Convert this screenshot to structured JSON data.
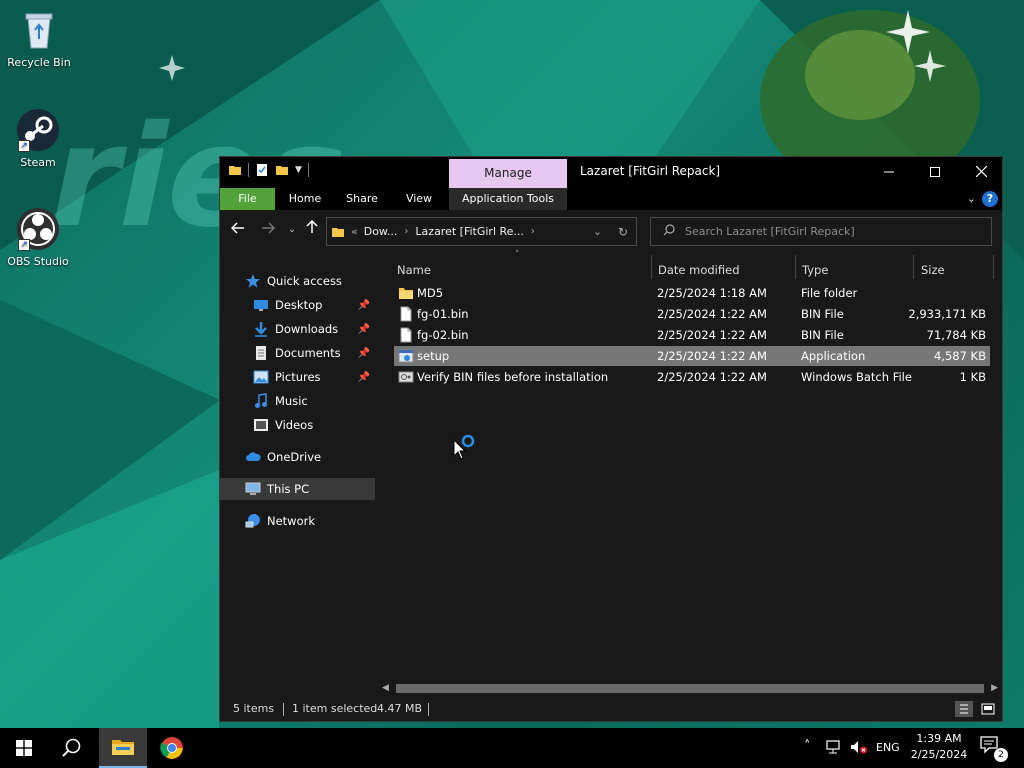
{
  "desktop": {
    "icons": [
      {
        "label": "Recycle Bin"
      },
      {
        "label": "Steam"
      },
      {
        "label": "OBS Studio"
      }
    ]
  },
  "window": {
    "title": "Lazaret [FitGirl Repack]",
    "context_tab": "Manage",
    "ribbon_tabs": [
      "File",
      "Home",
      "Share",
      "View",
      "Application Tools"
    ],
    "help_label": "?",
    "address": {
      "overflow": "«",
      "crumbs": [
        "Dow...",
        "Lazaret [FitGirl Re..."
      ]
    },
    "search_placeholder": "Search Lazaret [FitGirl Repack]",
    "nav": {
      "quick_access": "Quick access",
      "items": [
        {
          "label": "Desktop",
          "pinned": true
        },
        {
          "label": "Downloads",
          "pinned": true
        },
        {
          "label": "Documents",
          "pinned": true
        },
        {
          "label": "Pictures",
          "pinned": true
        },
        {
          "label": "Music",
          "pinned": false
        },
        {
          "label": "Videos",
          "pinned": false
        }
      ],
      "onedrive": "OneDrive",
      "this_pc": "This PC",
      "network": "Network"
    },
    "columns": {
      "name": "Name",
      "date": "Date modified",
      "type": "Type",
      "size": "Size"
    },
    "files": [
      {
        "name": "MD5",
        "date": "2/25/2024 1:18 AM",
        "type": "File folder",
        "size": "",
        "icon": "folder-icon"
      },
      {
        "name": "fg-01.bin",
        "date": "2/25/2024 1:22 AM",
        "type": "BIN File",
        "size": "2,933,171 KB",
        "icon": "file-icon"
      },
      {
        "name": "fg-02.bin",
        "date": "2/25/2024 1:22 AM",
        "type": "BIN File",
        "size": "71,784 KB",
        "icon": "file-icon"
      },
      {
        "name": "setup",
        "date": "2/25/2024 1:22 AM",
        "type": "Application",
        "size": "4,587 KB",
        "icon": "application-icon"
      },
      {
        "name": "Verify BIN files before installation",
        "date": "2/25/2024 1:22 AM",
        "type": "Windows Batch File",
        "size": "1 KB",
        "icon": "batch-file-icon"
      }
    ],
    "status": {
      "item_count": "5 items",
      "selection": "1 item selected",
      "selection_size": "4.47 MB"
    }
  },
  "taskbar": {
    "language": "ENG",
    "time": "1:39 AM",
    "date": "2/25/2024",
    "notification_count": "2"
  },
  "colors": {
    "file_tab": "#54a33a",
    "manage_tab": "#e7c6ef",
    "selection": "#777777",
    "accent": "#1f6fd1"
  }
}
